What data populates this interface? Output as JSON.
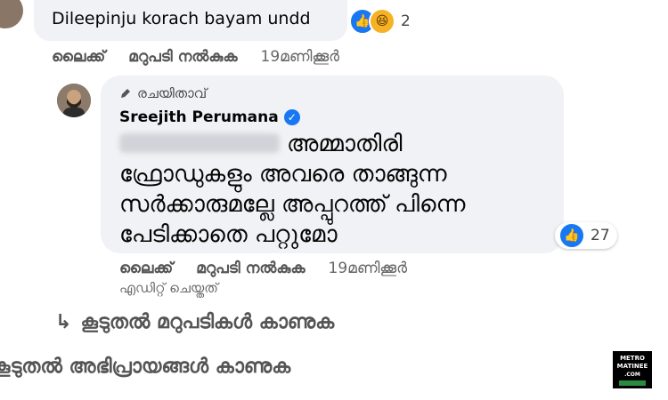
{
  "comment1": {
    "text": "Dileepinju korach bayam undd",
    "reaction_count": "2",
    "actions": {
      "like": "ലൈക്ക്",
      "reply": "മറുപടി നൽകുക",
      "time": "19മണിക്കൂർ"
    }
  },
  "reply": {
    "badge": "രചയിതാവ്",
    "author": "Sreejith Perumana",
    "lines": [
      "അമ്മാതിരി",
      "ഫ്രോഡുകളും അവരെ താങ്ങുന്ന",
      "സർക്കാരുമല്ലേ അപ്പുറത്ത് പിന്നെ",
      "പേടിക്കാതെ പറ്റുമോ"
    ],
    "reaction_count": "27",
    "actions": {
      "like": "ലൈക്ക്",
      "reply": "മറുപടി നൽകുക",
      "time": "19മണിക്കൂർ"
    },
    "edited": "എഡിറ്റ് ചെയ്തത്"
  },
  "more_replies": "കൂടുതൽ മറുപടികൾ കാണുക",
  "more_comments": "കൂടുതൽ അഭിപ്രായങ്ങൾ കാണുക",
  "logo": {
    "line1": "METRO",
    "line2": "MATINEE",
    "line3": ".COM"
  }
}
